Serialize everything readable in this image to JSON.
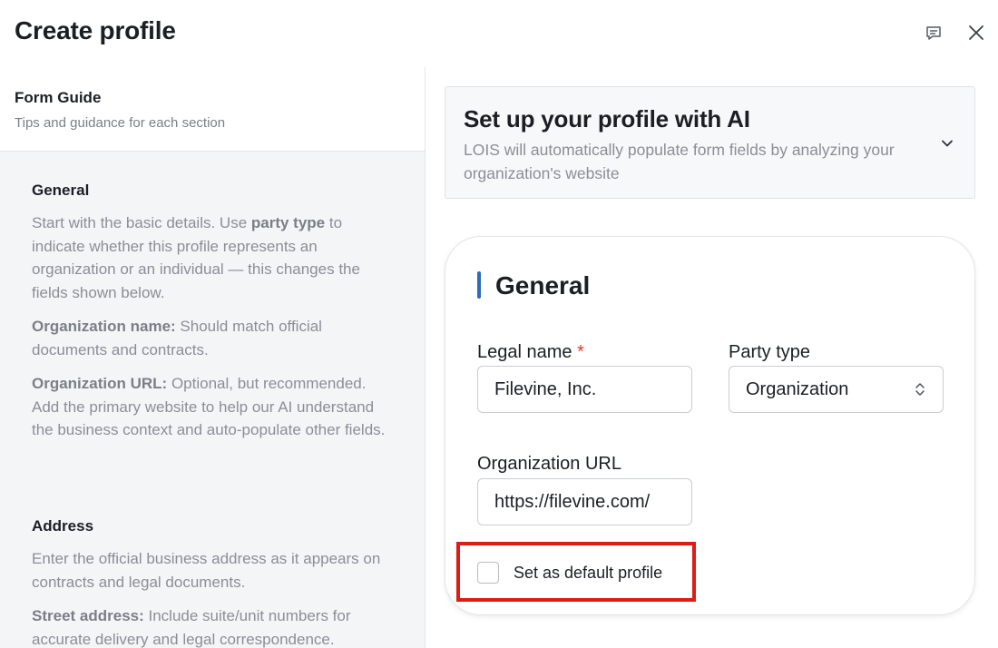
{
  "header": {
    "title": "Create profile",
    "feedback_icon": "chat-bubble-icon",
    "close_icon": "close-icon"
  },
  "guide": {
    "title": "Form Guide",
    "subtitle": "Tips and guidance for each section",
    "general": {
      "heading": "General",
      "p1_a": "Start with the basic details. Use ",
      "p1_b": "party type",
      "p1_c": " to indicate whether this profile represents an organization or an individual — this changes the fields shown below.",
      "p2_b": "Organization name:",
      "p2_c": " Should match official documents and contracts.",
      "p3_b": "Organization URL:",
      "p3_c": " Optional, but recommended. Add the primary website to help our AI understand the business context and auto-populate other fields."
    },
    "address": {
      "heading": "Address",
      "p1": "Enter the official business address as it appears on contracts and legal documents.",
      "p2_b": "Street address:",
      "p2_c": " Include suite/unit numbers for accurate delivery and legal correspondence."
    }
  },
  "ai_setup": {
    "title": "Set up your profile with AI",
    "description": "LOIS will automatically populate form fields by analyzing your organization's website",
    "chevron_icon": "chevron-down-icon"
  },
  "general_form": {
    "title": "General",
    "legal_name_label": "Legal name",
    "required_mark": "*",
    "legal_name_value": "Filevine, Inc.",
    "party_type_label": "Party type",
    "party_type_value": "Organization",
    "org_url_label": "Organization URL",
    "org_url_value": "https://filevine.com/",
    "default_profile_label": "Set as default profile",
    "default_profile_checked": false
  },
  "colors": {
    "accent_bar": "#2e6cb8",
    "required": "#d93a2b",
    "highlight": "#e01b16"
  }
}
